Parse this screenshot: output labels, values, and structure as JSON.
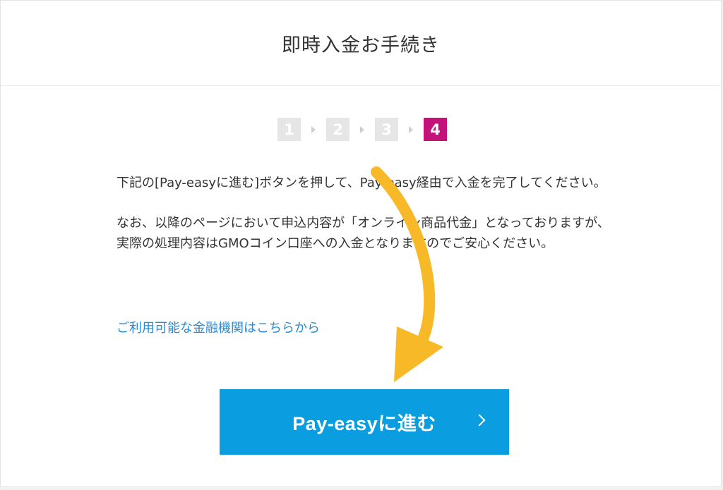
{
  "header": {
    "title": "即時入金お手続き"
  },
  "steps": {
    "items": [
      "1",
      "2",
      "3",
      "4"
    ],
    "active_index": 3
  },
  "content": {
    "paragraph1": "下記の[Pay-easyに進む]ボタンを押して、Pay-easy経由で入金を完了してください。",
    "paragraph2": "なお、以降のページにおいて申込内容が「オンライン商品代金」となっておりますが、実際の処理内容はGMOコイン口座への入金となりますのでご安心ください。"
  },
  "link": {
    "label": "ご利用可能な金融機関はこちらから"
  },
  "button": {
    "label": "Pay-easyに進む"
  },
  "colors": {
    "active_step": "#c3137b",
    "button": "#0a9ddf",
    "link": "#2a8cd3",
    "arrow": "#f7b928"
  }
}
